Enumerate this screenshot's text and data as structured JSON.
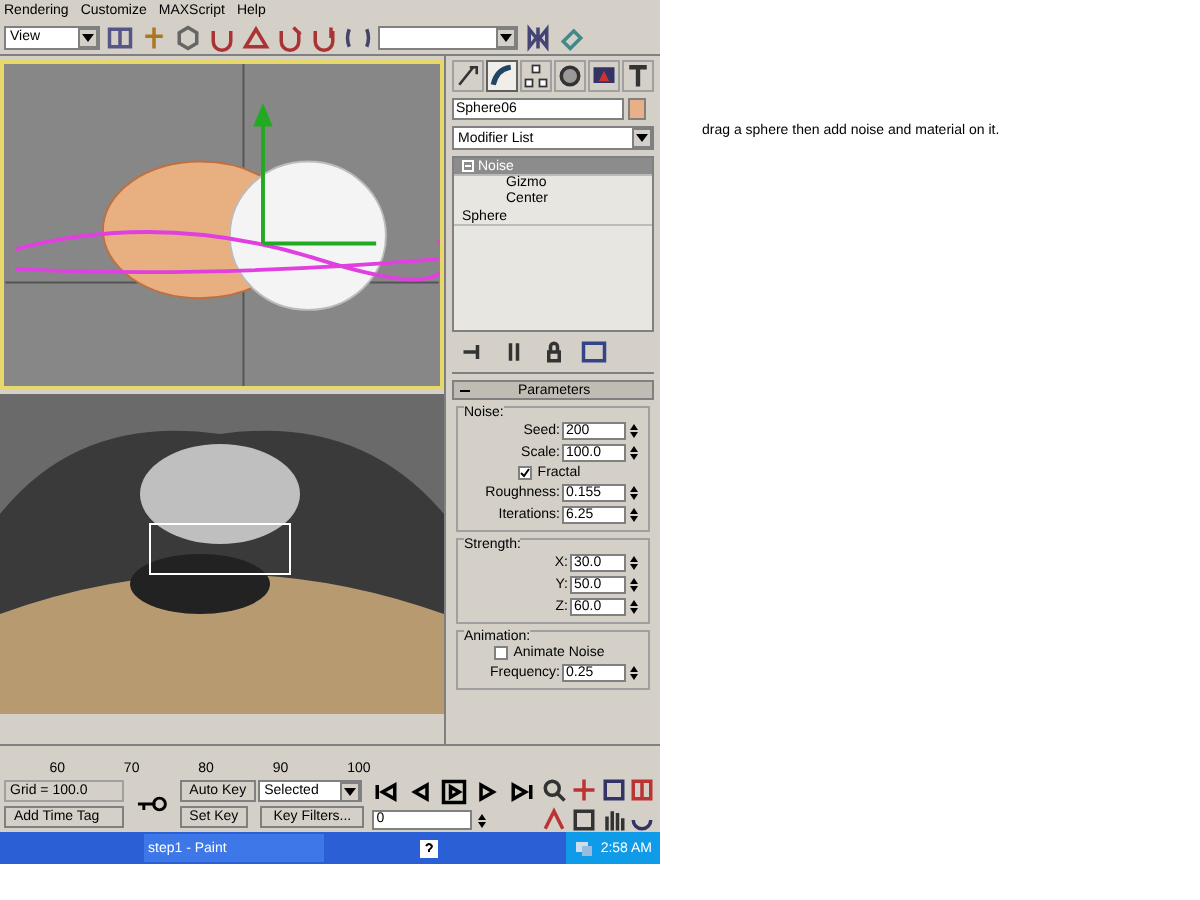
{
  "menu": [
    "Rendering",
    "Customize",
    "MAXScript",
    "Help"
  ],
  "toolbar": {
    "view_dropdown": "View"
  },
  "command_panel": {
    "tabs": [
      {
        "kind": "create",
        "selected": false
      },
      {
        "kind": "modify",
        "selected": true
      },
      {
        "kind": "hierarchy",
        "selected": false
      },
      {
        "kind": "motion",
        "selected": false
      },
      {
        "kind": "display",
        "selected": false
      },
      {
        "kind": "utilities",
        "selected": false
      }
    ],
    "object_name": "Sphere06",
    "modifier_list": "Modifier List",
    "stack": [
      {
        "label": "Noise",
        "selected": true,
        "expanded": true,
        "children": [
          {
            "label": "Gizmo"
          },
          {
            "label": "Center"
          }
        ]
      },
      {
        "label": "Sphere",
        "selected": false
      }
    ],
    "rollout": {
      "title": "Parameters",
      "expanded": true,
      "groups": [
        {
          "title": "Noise:",
          "rows": [
            {
              "kind": "spinner",
              "label": "Seed:",
              "value": "200"
            },
            {
              "kind": "spinner",
              "label": "Scale:",
              "value": "100.0"
            },
            {
              "kind": "checkbox",
              "label": "Fractal",
              "checked": true
            },
            {
              "kind": "spinner",
              "label": "Roughness:",
              "value": "0.155"
            },
            {
              "kind": "spinner",
              "label": "Iterations:",
              "value": "6.25"
            }
          ]
        },
        {
          "title": "Strength:",
          "rows": [
            {
              "kind": "spinner",
              "label": "X:",
              "value": "30.0"
            },
            {
              "kind": "spinner",
              "label": "Y:",
              "value": "50.0"
            },
            {
              "kind": "spinner",
              "label": "Z:",
              "value": "60.0"
            }
          ]
        },
        {
          "title": "Animation:",
          "rows": [
            {
              "kind": "checkbox",
              "label": "Animate Noise",
              "checked": false
            },
            {
              "kind": "spinner",
              "label": "Frequency:",
              "value": "0.25"
            }
          ]
        }
      ]
    }
  },
  "timeline": {
    "ticks": [
      "60",
      "70",
      "80",
      "90",
      "100"
    ]
  },
  "status": {
    "grid": "Grid = 100.0",
    "time_tag": "Add Time Tag",
    "auto_key": "Auto Key",
    "key_mode": "Selected",
    "set_key": "Set Key",
    "key_filters": "Key Filters...",
    "frame": "0"
  },
  "taskbar": {
    "task": "step1 - Paint",
    "clock": "2:58 AM"
  },
  "note": "drag a sphere then add noise and material on it."
}
